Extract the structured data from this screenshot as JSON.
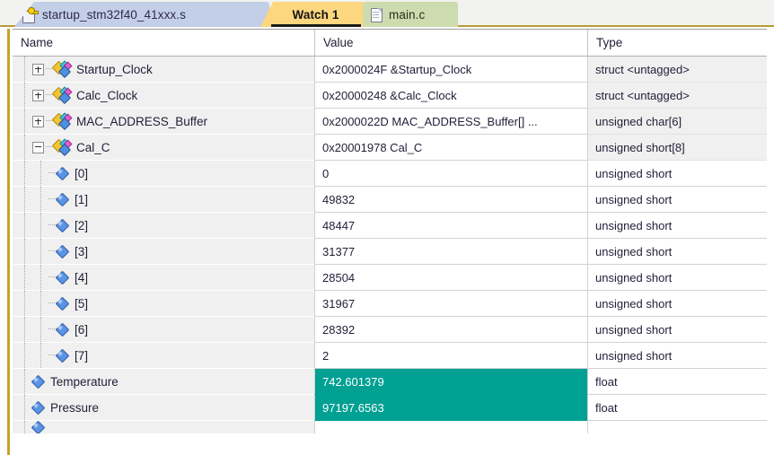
{
  "tabs": [
    {
      "id": "startup",
      "label": "startup_stm32f40_41xxx.s",
      "icon": "clipboard-key-icon",
      "active": false,
      "color": "#c3cfe6"
    },
    {
      "id": "watch1",
      "label": "Watch 1",
      "icon": "none",
      "active": true,
      "color": "#fcd77f"
    },
    {
      "id": "main",
      "label": "main.c",
      "icon": "document-icon",
      "active": false,
      "color": "#cddcae"
    }
  ],
  "grid": {
    "columns": [
      {
        "key": "name",
        "label": "Name"
      },
      {
        "key": "value",
        "label": "Value"
      },
      {
        "key": "type",
        "label": "Type"
      }
    ],
    "changed_highlight_color": "#00a093",
    "rows": [
      {
        "name": "Startup_Clock",
        "value": "0x2000024F &Startup_Clock",
        "type": "struct <untagged>",
        "depth": 0,
        "expander": "plus",
        "icon": "struct-icon",
        "changed": false,
        "type_shaded": true
      },
      {
        "name": "Calc_Clock",
        "value": "0x20000248 &Calc_Clock",
        "type": "struct <untagged>",
        "depth": 0,
        "expander": "plus",
        "icon": "struct-icon",
        "changed": false,
        "type_shaded": true
      },
      {
        "name": "MAC_ADDRESS_Buffer",
        "value": "0x2000022D MAC_ADDRESS_Buffer[] ...",
        "type": "unsigned char[6]",
        "depth": 0,
        "expander": "plus",
        "icon": "struct-icon",
        "changed": false,
        "type_shaded": true
      },
      {
        "name": "Cal_C",
        "value": "0x20001978 Cal_C",
        "type": "unsigned short[8]",
        "depth": 0,
        "expander": "minus",
        "icon": "struct-icon",
        "changed": false,
        "type_shaded": true
      },
      {
        "name": "[0]",
        "value": "0",
        "type": "unsigned short",
        "depth": 1,
        "expander": "none",
        "icon": "variable-icon",
        "changed": false,
        "type_shaded": false
      },
      {
        "name": "[1]",
        "value": "49832",
        "type": "unsigned short",
        "depth": 1,
        "expander": "none",
        "icon": "variable-icon",
        "changed": false,
        "type_shaded": false
      },
      {
        "name": "[2]",
        "value": "48447",
        "type": "unsigned short",
        "depth": 1,
        "expander": "none",
        "icon": "variable-icon",
        "changed": false,
        "type_shaded": false
      },
      {
        "name": "[3]",
        "value": "31377",
        "type": "unsigned short",
        "depth": 1,
        "expander": "none",
        "icon": "variable-icon",
        "changed": false,
        "type_shaded": false
      },
      {
        "name": "[4]",
        "value": "28504",
        "type": "unsigned short",
        "depth": 1,
        "expander": "none",
        "icon": "variable-icon",
        "changed": false,
        "type_shaded": false
      },
      {
        "name": "[5]",
        "value": "31967",
        "type": "unsigned short",
        "depth": 1,
        "expander": "none",
        "icon": "variable-icon",
        "changed": false,
        "type_shaded": false
      },
      {
        "name": "[6]",
        "value": "28392",
        "type": "unsigned short",
        "depth": 1,
        "expander": "none",
        "icon": "variable-icon",
        "changed": false,
        "type_shaded": false
      },
      {
        "name": "[7]",
        "value": "2",
        "type": "unsigned short",
        "depth": 1,
        "expander": "none",
        "icon": "variable-icon",
        "changed": false,
        "type_shaded": false
      },
      {
        "name": "Temperature",
        "value": "742.601379",
        "type": "float",
        "depth": 0,
        "expander": "none",
        "icon": "variable-icon",
        "changed": true,
        "type_shaded": false
      },
      {
        "name": "Pressure",
        "value": "97197.6563",
        "type": "float",
        "depth": 0,
        "expander": "none",
        "icon": "variable-icon",
        "changed": true,
        "type_shaded": false
      },
      {
        "name": "",
        "value": "",
        "type": "",
        "depth": 0,
        "expander": "none",
        "icon": "variable-icon",
        "changed": false,
        "type_shaded": false,
        "partial": true
      }
    ]
  }
}
